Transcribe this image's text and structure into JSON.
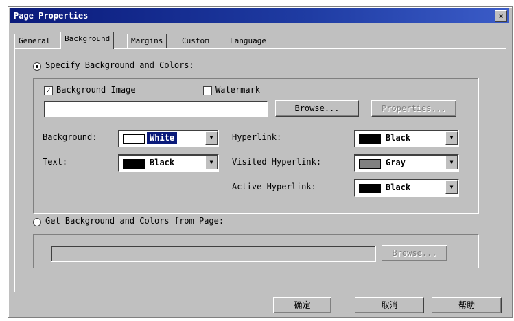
{
  "window": {
    "title": "Page Properties",
    "close_glyph": "×"
  },
  "tabs": [
    {
      "label": "General"
    },
    {
      "label": "Background"
    },
    {
      "label": "Margins"
    },
    {
      "label": "Custom"
    },
    {
      "label": "Language"
    }
  ],
  "specify": {
    "label": "Specify Background and Colors:",
    "background_image_label": "Background Image",
    "background_image_checked": true,
    "watermark_label": "Watermark",
    "watermark_checked": false,
    "image_path_value": "",
    "browse_label": "Browse...",
    "properties_label": "Properties..."
  },
  "colors": {
    "background": {
      "label": "Background:",
      "value": "White",
      "swatch": "#ffffff"
    },
    "text": {
      "label": "Text:",
      "value": "Black",
      "swatch": "#000000"
    },
    "hyperlink": {
      "label": "Hyperlink:",
      "value": "Black",
      "swatch": "#000000"
    },
    "visited": {
      "label": "Visited Hyperlink:",
      "value": "Gray",
      "swatch": "#808080"
    },
    "active": {
      "label": "Active Hyperlink:",
      "value": "Black",
      "swatch": "#000000"
    }
  },
  "get_from_page": {
    "label": "Get Background and Colors from Page:",
    "path_value": "",
    "browse_label": "Browse..."
  },
  "footer": {
    "ok_label": "确定",
    "cancel_label": "取消",
    "help_label": "帮助"
  }
}
